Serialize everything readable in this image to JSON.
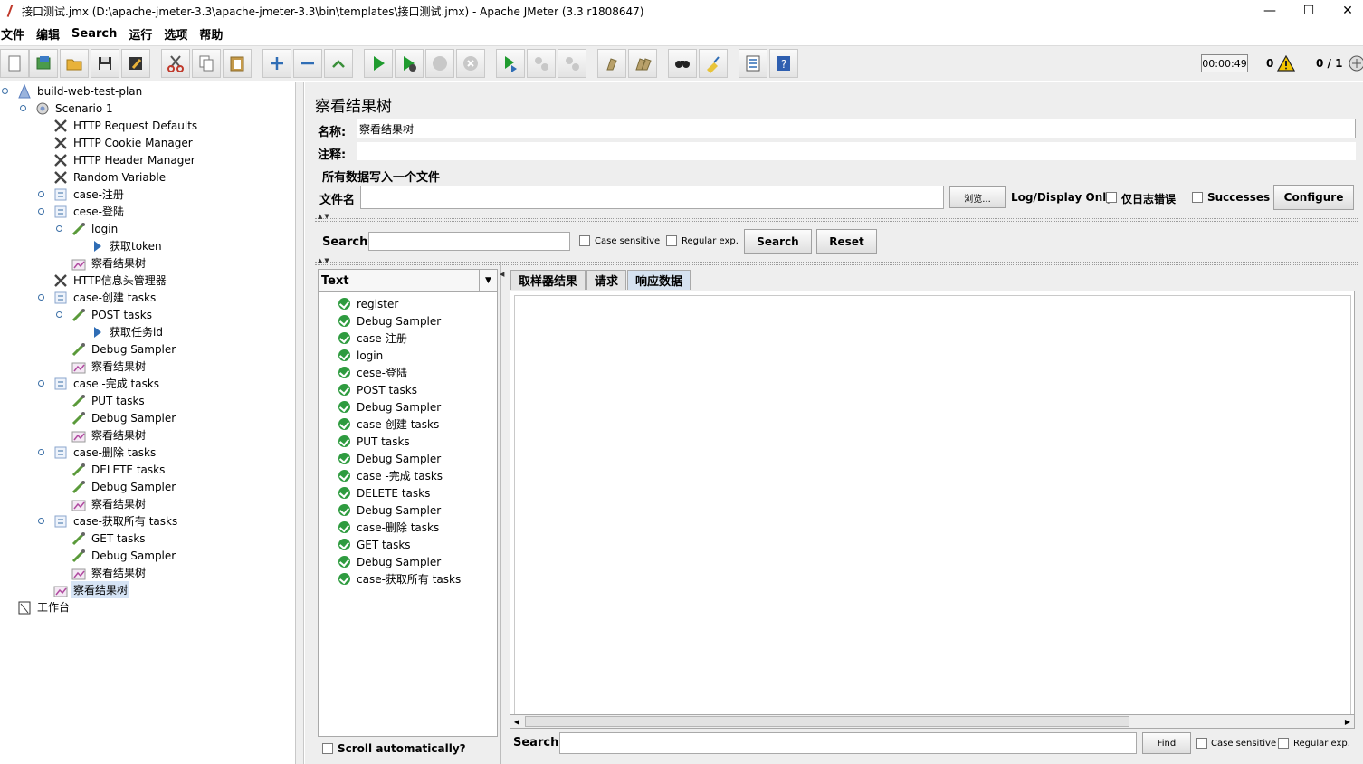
{
  "window": {
    "title": "接口测试.jmx (D:\\apache-jmeter-3.3\\apache-jmeter-3.3\\bin\\templates\\接口测试.jmx) - Apache JMeter (3.3 r1808647)",
    "minimize": "—",
    "maximize": "☐",
    "close": "✕"
  },
  "menu": [
    "文件",
    "编辑",
    "Search",
    "运行",
    "选项",
    "帮助"
  ],
  "toolbar": {
    "buttons": [
      "new-icon",
      "templates-icon",
      "open-icon",
      "save-icon",
      "save-as-icon",
      "cut-icon",
      "copy-icon",
      "paste-icon",
      "expand-icon",
      "collapse-icon",
      "toggle-icon",
      "start-icon",
      "start-no-pause-icon",
      "stop-icon",
      "shutdown-icon",
      "remote-start-icon",
      "remote-stop-icon",
      "remote-shutdown-icon",
      "clear-icon",
      "clear-all-icon",
      "search-icon",
      "reset-search-icon",
      "function-helper-icon",
      "help-icon"
    ],
    "elapsed_time": "00:00:49",
    "error_count": "0",
    "threads": "0 / 1"
  },
  "tree": {
    "items": [
      {
        "label": "build-web-test-plan",
        "icon": "test-plan-icon"
      },
      {
        "label": "Scenario 1",
        "icon": "thread-group-icon"
      },
      {
        "label": "HTTP Request Defaults",
        "icon": "config-element-icon"
      },
      {
        "label": "HTTP Cookie Manager",
        "icon": "config-element-icon"
      },
      {
        "label": "HTTP Header Manager",
        "icon": "config-element-icon"
      },
      {
        "label": "Random Variable",
        "icon": "config-element-icon"
      },
      {
        "label": "case-注册",
        "icon": "transaction-controller-icon"
      },
      {
        "label": "cese-登陆",
        "icon": "transaction-controller-icon"
      },
      {
        "label": "login",
        "icon": "sampler-icon"
      },
      {
        "label": "获取token",
        "icon": "extractor-icon"
      },
      {
        "label": "察看结果树",
        "icon": "listener-icon"
      },
      {
        "label": "HTTP信息头管理器",
        "icon": "config-element-icon"
      },
      {
        "label": "case-创建 tasks",
        "icon": "transaction-controller-icon"
      },
      {
        "label": "POST tasks",
        "icon": "sampler-icon"
      },
      {
        "label": "获取任务id",
        "icon": "extractor-icon"
      },
      {
        "label": "Debug Sampler",
        "icon": "sampler-icon"
      },
      {
        "label": "察看结果树",
        "icon": "listener-icon"
      },
      {
        "label": "case -完成 tasks",
        "icon": "transaction-controller-icon"
      },
      {
        "label": "PUT tasks",
        "icon": "sampler-icon"
      },
      {
        "label": "Debug Sampler",
        "icon": "sampler-icon"
      },
      {
        "label": "察看结果树",
        "icon": "listener-icon"
      },
      {
        "label": "case-删除 tasks",
        "icon": "transaction-controller-icon"
      },
      {
        "label": "DELETE  tasks",
        "icon": "sampler-icon"
      },
      {
        "label": "Debug Sampler",
        "icon": "sampler-icon"
      },
      {
        "label": "察看结果树",
        "icon": "listener-icon"
      },
      {
        "label": "case-获取所有 tasks",
        "icon": "transaction-controller-icon"
      },
      {
        "label": "GET tasks",
        "icon": "sampler-icon"
      },
      {
        "label": "Debug Sampler",
        "icon": "sampler-icon"
      },
      {
        "label": "察看结果树",
        "icon": "listener-icon"
      },
      {
        "label": "察看结果树",
        "icon": "listener-icon"
      },
      {
        "label": "工作台",
        "icon": "workbench-icon"
      }
    ]
  },
  "panel": {
    "title": "察看结果树",
    "name_label": "名称:",
    "name_value": "察看结果树",
    "comment_label": "注释:",
    "file_group_title": "所有数据写入一个文件",
    "filename_label": "文件名",
    "browse_label": "浏览...",
    "log_display_label": "Log/Display Only:",
    "errors_only_label": "仅日志错误",
    "successes_label": "Successes",
    "configure_label": "Configure"
  },
  "search_bar": {
    "label": "Search:",
    "case_sensitive": "Case sensitive",
    "regular_exp": "Regular exp.",
    "search_button": "Search",
    "reset_button": "Reset"
  },
  "results": {
    "renderer": "Text",
    "items": [
      "register",
      "Debug Sampler",
      "case-注册",
      "login",
      "cese-登陆",
      "POST tasks",
      "Debug Sampler",
      "case-创建 tasks",
      "PUT tasks",
      "Debug Sampler",
      "case -完成 tasks",
      "DELETE  tasks",
      "Debug Sampler",
      "case-删除 tasks",
      "GET tasks",
      "Debug Sampler",
      "case-获取所有 tasks"
    ],
    "scroll_auto": "Scroll automatically?"
  },
  "tabs": [
    "取样器结果",
    "请求",
    "响应数据"
  ],
  "response_search": {
    "label": "Search:",
    "find_button": "Find",
    "case_sensitive": "Case sensitive",
    "regular_exp": "Regular exp."
  }
}
